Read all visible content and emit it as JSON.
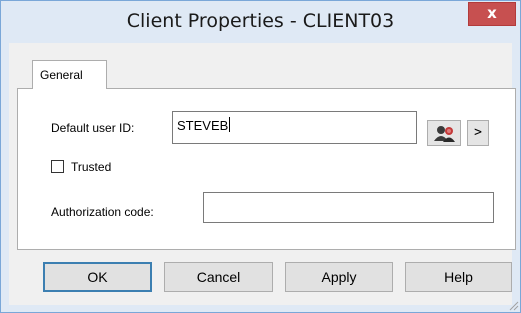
{
  "window": {
    "title": "Client Properties - CLIENT03",
    "close_symbol": "x"
  },
  "tabs": [
    {
      "label": "General",
      "selected": true
    }
  ],
  "general": {
    "default_user_id_label": "Default user ID:",
    "default_user_id_value": "STEVEB",
    "browse_arrow": ">",
    "trusted_label": "Trusted",
    "trusted_checked": false,
    "authorization_code_label": "Authorization code:",
    "authorization_code_value": ""
  },
  "buttons": {
    "ok": "OK",
    "cancel": "Cancel",
    "apply": "Apply",
    "help": "Help"
  },
  "colors": {
    "titlebar": "#dfe9f5",
    "close_button": "#c75050",
    "dialog_face": "#f0f0f0",
    "default_button_border": "#3c7fb1"
  },
  "icons": {
    "user_lookup": "users-lookup-icon",
    "resize": "resize-grip-icon"
  }
}
